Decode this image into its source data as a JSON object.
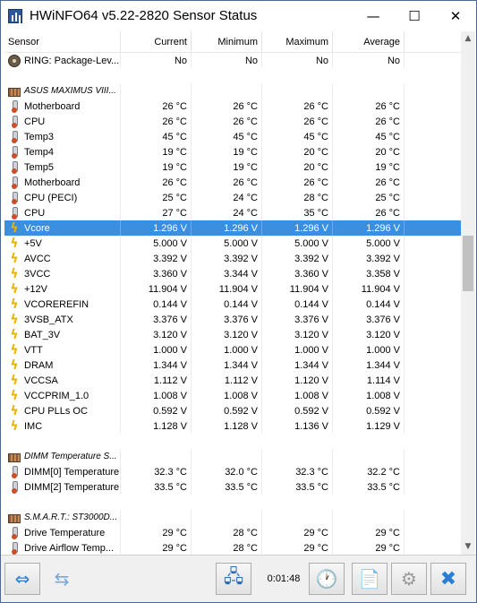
{
  "window": {
    "title": "HWiNFO64 v5.22-2820 Sensor Status",
    "minimize_glyph": "—",
    "maximize_glyph": "☐",
    "close_glyph": "✕"
  },
  "columns": [
    "Sensor",
    "Current",
    "Minimum",
    "Maximum",
    "Average"
  ],
  "rows": [
    {
      "type": "sensor",
      "icon": "ring-icon",
      "name": "RING: Package-Lev...",
      "current": "No",
      "minimum": "No",
      "maximum": "No",
      "average": "No"
    },
    {
      "type": "spacer"
    },
    {
      "type": "group",
      "icon": "board-icon",
      "name": "ASUS MAXIMUS VIII..."
    },
    {
      "type": "sensor",
      "icon": "thermometer-icon",
      "name": "Motherboard",
      "current": "26 °C",
      "minimum": "26 °C",
      "maximum": "26 °C",
      "average": "26 °C"
    },
    {
      "type": "sensor",
      "icon": "thermometer-icon",
      "name": "CPU",
      "current": "26 °C",
      "minimum": "26 °C",
      "maximum": "26 °C",
      "average": "26 °C"
    },
    {
      "type": "sensor",
      "icon": "thermometer-icon",
      "name": "Temp3",
      "current": "45 °C",
      "minimum": "45 °C",
      "maximum": "45 °C",
      "average": "45 °C"
    },
    {
      "type": "sensor",
      "icon": "thermometer-icon",
      "name": "Temp4",
      "current": "19 °C",
      "minimum": "19 °C",
      "maximum": "20 °C",
      "average": "20 °C"
    },
    {
      "type": "sensor",
      "icon": "thermometer-icon",
      "name": "Temp5",
      "current": "19 °C",
      "minimum": "19 °C",
      "maximum": "20 °C",
      "average": "19 °C"
    },
    {
      "type": "sensor",
      "icon": "thermometer-icon",
      "name": "Motherboard",
      "current": "26 °C",
      "minimum": "26 °C",
      "maximum": "26 °C",
      "average": "26 °C"
    },
    {
      "type": "sensor",
      "icon": "thermometer-icon",
      "name": "CPU (PECI)",
      "current": "25 °C",
      "minimum": "24 °C",
      "maximum": "28 °C",
      "average": "25 °C"
    },
    {
      "type": "sensor",
      "icon": "thermometer-icon",
      "name": "CPU",
      "current": "27 °C",
      "minimum": "24 °C",
      "maximum": "35 °C",
      "average": "26 °C"
    },
    {
      "type": "sensor",
      "icon": "voltage-icon",
      "name": "Vcore",
      "current": "1.296 V",
      "minimum": "1.296 V",
      "maximum": "1.296 V",
      "average": "1.296 V",
      "selected": true
    },
    {
      "type": "sensor",
      "icon": "voltage-icon",
      "name": "+5V",
      "current": "5.000 V",
      "minimum": "5.000 V",
      "maximum": "5.000 V",
      "average": "5.000 V"
    },
    {
      "type": "sensor",
      "icon": "voltage-icon",
      "name": "AVCC",
      "current": "3.392 V",
      "minimum": "3.392 V",
      "maximum": "3.392 V",
      "average": "3.392 V"
    },
    {
      "type": "sensor",
      "icon": "voltage-icon",
      "name": "3VCC",
      "current": "3.360 V",
      "minimum": "3.344 V",
      "maximum": "3.360 V",
      "average": "3.358 V"
    },
    {
      "type": "sensor",
      "icon": "voltage-icon",
      "name": "+12V",
      "current": "11.904 V",
      "minimum": "11.904 V",
      "maximum": "11.904 V",
      "average": "11.904 V"
    },
    {
      "type": "sensor",
      "icon": "voltage-icon",
      "name": "VCOREREFIN",
      "current": "0.144 V",
      "minimum": "0.144 V",
      "maximum": "0.144 V",
      "average": "0.144 V"
    },
    {
      "type": "sensor",
      "icon": "voltage-icon",
      "name": "3VSB_ATX",
      "current": "3.376 V",
      "minimum": "3.376 V",
      "maximum": "3.376 V",
      "average": "3.376 V"
    },
    {
      "type": "sensor",
      "icon": "voltage-icon",
      "name": "BAT_3V",
      "current": "3.120 V",
      "minimum": "3.120 V",
      "maximum": "3.120 V",
      "average": "3.120 V"
    },
    {
      "type": "sensor",
      "icon": "voltage-icon",
      "name": "VTT",
      "current": "1.000 V",
      "minimum": "1.000 V",
      "maximum": "1.000 V",
      "average": "1.000 V"
    },
    {
      "type": "sensor",
      "icon": "voltage-icon",
      "name": "DRAM",
      "current": "1.344 V",
      "minimum": "1.344 V",
      "maximum": "1.344 V",
      "average": "1.344 V"
    },
    {
      "type": "sensor",
      "icon": "voltage-icon",
      "name": "VCCSA",
      "current": "1.112 V",
      "minimum": "1.112 V",
      "maximum": "1.120 V",
      "average": "1.114 V"
    },
    {
      "type": "sensor",
      "icon": "voltage-icon",
      "name": "VCCPRIM_1.0",
      "current": "1.008 V",
      "minimum": "1.008 V",
      "maximum": "1.008 V",
      "average": "1.008 V"
    },
    {
      "type": "sensor",
      "icon": "voltage-icon",
      "name": "CPU PLLs OC",
      "current": "0.592 V",
      "minimum": "0.592 V",
      "maximum": "0.592 V",
      "average": "0.592 V"
    },
    {
      "type": "sensor",
      "icon": "voltage-icon",
      "name": "IMC",
      "current": "1.128 V",
      "minimum": "1.128 V",
      "maximum": "1.136 V",
      "average": "1.129 V"
    },
    {
      "type": "spacer"
    },
    {
      "type": "group",
      "icon": "board-icon",
      "name": "DIMM Temperature S..."
    },
    {
      "type": "sensor",
      "icon": "thermometer-icon",
      "name": "DIMM[0] Temperature",
      "current": "32.3 °C",
      "minimum": "32.0 °C",
      "maximum": "32.3 °C",
      "average": "32.2 °C"
    },
    {
      "type": "sensor",
      "icon": "thermometer-icon",
      "name": "DIMM[2] Temperature",
      "current": "33.5 °C",
      "minimum": "33.5 °C",
      "maximum": "33.5 °C",
      "average": "33.5 °C"
    },
    {
      "type": "spacer"
    },
    {
      "type": "group",
      "icon": "board-icon",
      "name": "S.M.A.R.T.: ST3000D..."
    },
    {
      "type": "sensor",
      "icon": "thermometer-icon",
      "name": "Drive Temperature",
      "current": "29 °C",
      "minimum": "28 °C",
      "maximum": "29 °C",
      "average": "29 °C"
    },
    {
      "type": "sensor",
      "icon": "thermometer-icon",
      "name": "Drive Airflow Temp...",
      "current": "29 °C",
      "minimum": "28 °C",
      "maximum": "29 °C",
      "average": "29 °C"
    }
  ],
  "scrollbar": {
    "up_arrow": "▲",
    "down_arrow": "▼"
  },
  "toolbar": {
    "elapsed_time": "0:01:48",
    "buttons": [
      {
        "name": "expand-arrows-button",
        "icon": "left-right-arrows-icon",
        "glyph": "⇔",
        "color": "#2a7fd4"
      },
      {
        "name": "collapse-arrows-button",
        "icon": "inward-arrows-icon",
        "glyph": "⇆",
        "color": "#7aa8d8"
      },
      {
        "name": "network-button",
        "icon": "network-computers-icon",
        "glyph": "🖧",
        "color": "#2a6ab4"
      },
      {
        "name": "clock-button",
        "icon": "clock-icon",
        "glyph": "🕐",
        "color": "#333333"
      },
      {
        "name": "report-button",
        "icon": "add-document-icon",
        "glyph": "📄",
        "color": "#4a9a3a"
      },
      {
        "name": "settings-button",
        "icon": "gear-icon",
        "glyph": "⚙",
        "color": "#9a9a9a"
      },
      {
        "name": "close-sensors-button",
        "icon": "close-x-icon",
        "glyph": "✖",
        "color": "#2a7fd4"
      }
    ]
  }
}
